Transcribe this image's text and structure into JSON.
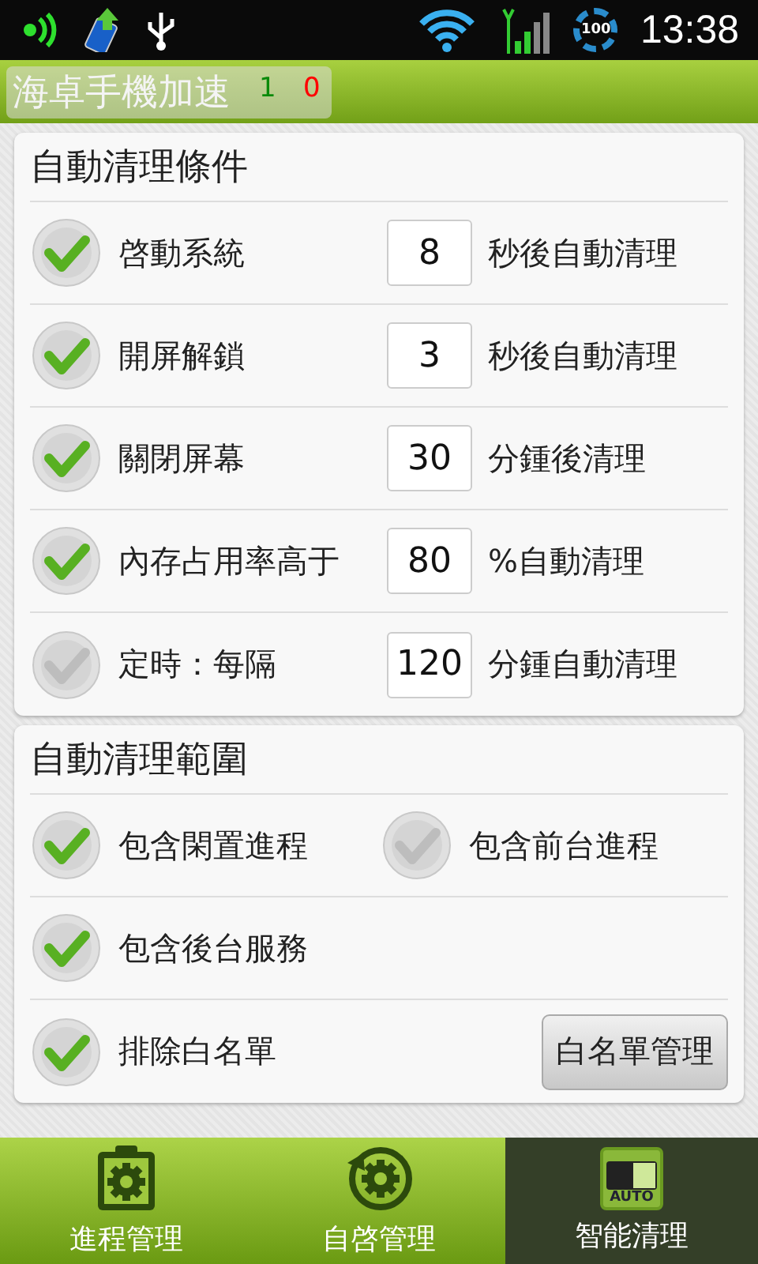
{
  "status_bar": {
    "time": "13:38",
    "battery": "100"
  },
  "title_bar": {
    "title": "海卓手機加速",
    "count_green": "1",
    "count_red": "0"
  },
  "conditions": {
    "title": "自動清理條件",
    "rows": [
      {
        "label": "啓動系統",
        "value": "8",
        "suffix": "秒後自動清理",
        "checked": true
      },
      {
        "label": "開屏解鎖",
        "value": "3",
        "suffix": "秒後自動清理",
        "checked": true
      },
      {
        "label": "關閉屏幕",
        "value": "30",
        "suffix": "分鍾後清理",
        "checked": true
      },
      {
        "label": "內存占用率高于",
        "value": "80",
        "suffix": "%自動清理",
        "checked": true
      },
      {
        "label": "定時：每隔",
        "value": "120",
        "suffix": "分鍾自動清理",
        "checked": false
      }
    ]
  },
  "scope": {
    "title": "自動清理範圍",
    "rows": [
      {
        "items": [
          {
            "label": "包含閑置進程",
            "checked": true
          },
          {
            "label": "包含前台進程",
            "checked": false
          }
        ]
      },
      {
        "items": [
          {
            "label": "包含後台服務",
            "checked": true
          }
        ]
      },
      {
        "items": [
          {
            "label": "排除白名單",
            "checked": true
          }
        ],
        "button": "白名單管理"
      }
    ]
  },
  "tabs": [
    {
      "kind": "clipboard",
      "label": "進程管理",
      "selected": false
    },
    {
      "kind": "cycle",
      "label": "自啓管理",
      "selected": false
    },
    {
      "kind": "auto",
      "label": "智能清理",
      "icon_text": "AUTO",
      "selected": true
    }
  ]
}
